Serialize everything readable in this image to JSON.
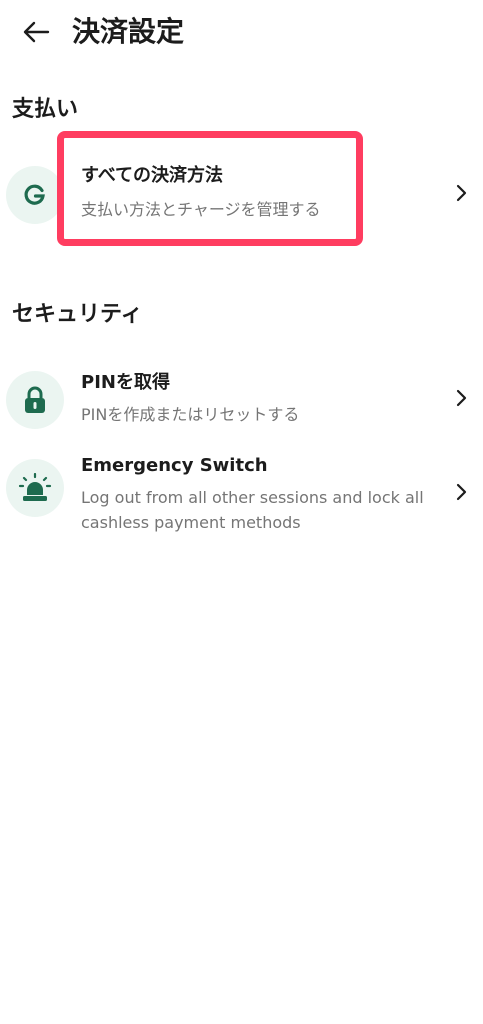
{
  "header": {
    "back_icon": "arrow-left-icon",
    "title": "決済設定"
  },
  "sections": {
    "payment": {
      "title": "支払い",
      "item_all_methods": {
        "icon": "g-logo-icon",
        "title": "すべての決済方法",
        "subtitle": "支払い方法とチャージを管理する"
      }
    },
    "security": {
      "title": "セキュリティ",
      "item_pin": {
        "icon": "lock-icon",
        "title": "PINを取得",
        "subtitle": "PINを作成またはリセットする"
      },
      "item_emergency": {
        "icon": "siren-icon",
        "title": "Emergency Switch",
        "subtitle": "Log out from all other sessions and lock all cashless payment methods"
      }
    }
  },
  "colors": {
    "accent_green": "#1e6b4f",
    "icon_bg": "#ebf5f1",
    "highlight": "#ff3d60",
    "subtitle_text": "#757575"
  }
}
